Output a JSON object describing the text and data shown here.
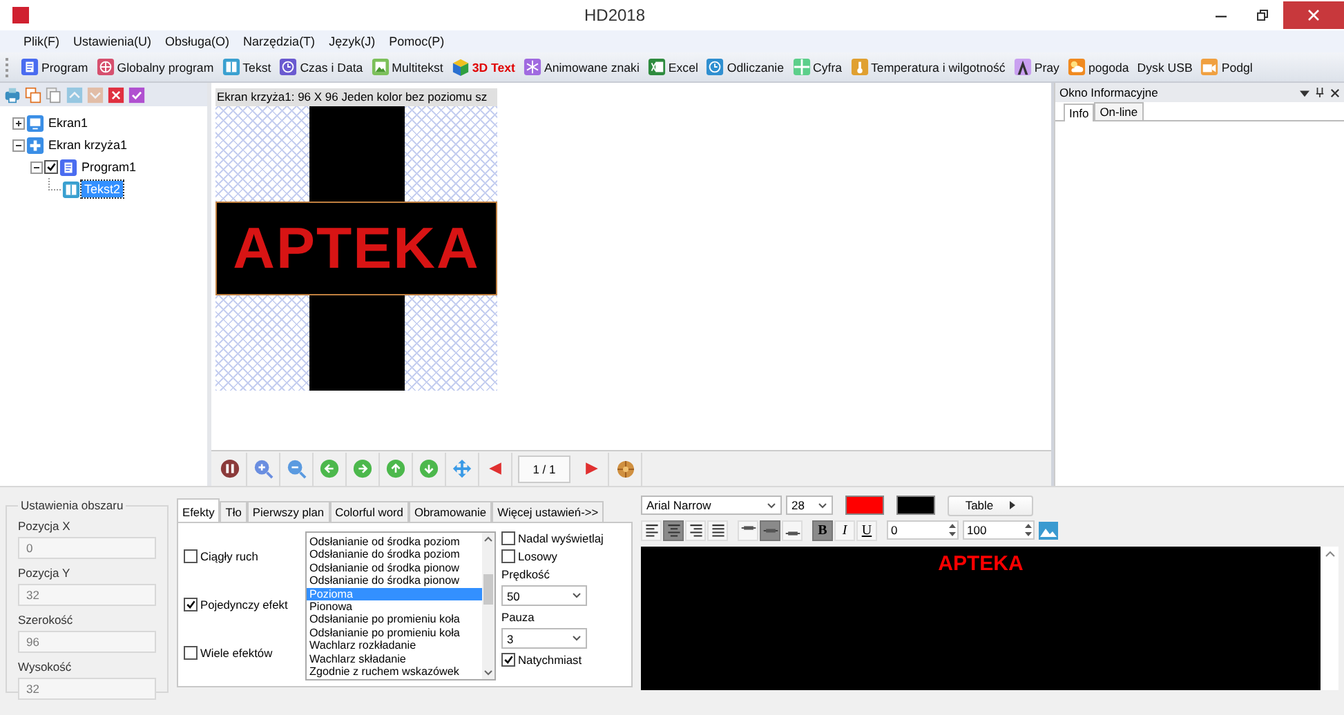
{
  "window": {
    "title": "HD2018"
  },
  "menu": [
    "Plik(F)",
    "Ustawienia(U)",
    "Obsługa(O)",
    "Narzędzia(T)",
    "Język(J)",
    "Pomoc(P)"
  ],
  "toolbar": [
    {
      "label": "Program",
      "kind": "program",
      "highlighted": false
    },
    {
      "label": "Globalny program",
      "kind": "globe",
      "highlighted": false
    },
    {
      "label": "Tekst",
      "kind": "book",
      "highlighted": false
    },
    {
      "label": "Czas i Data",
      "kind": "clock",
      "highlighted": false
    },
    {
      "label": "Multitekst",
      "kind": "picture",
      "highlighted": false
    },
    {
      "label": "3D Text",
      "kind": "cube",
      "highlighted": true
    },
    {
      "label": "Animowane znaki",
      "kind": "snowflake",
      "highlighted": false
    },
    {
      "label": "Excel",
      "kind": "spreadsheet",
      "highlighted": false
    },
    {
      "label": "Odliczanie",
      "kind": "alarm",
      "highlighted": false
    },
    {
      "label": "Cyfra",
      "kind": "grid",
      "highlighted": false
    },
    {
      "label": "Temperatura i wilgotność",
      "kind": "thermometer",
      "highlighted": false
    },
    {
      "label": "Pray",
      "kind": "tower",
      "highlighted": false
    },
    {
      "label": "pogoda",
      "kind": "weather",
      "highlighted": false
    },
    {
      "label": "Dysk USB",
      "kind": "text",
      "highlighted": false
    },
    {
      "label": "Podgl",
      "kind": "camera",
      "highlighted": false
    }
  ],
  "tree_tools": [
    {
      "kind": "print",
      "disabled": false
    },
    {
      "kind": "copy",
      "disabled": false
    },
    {
      "kind": "duplicate",
      "disabled": false
    },
    {
      "kind": "up",
      "disabled": true
    },
    {
      "kind": "down",
      "disabled": true
    },
    {
      "kind": "delete",
      "disabled": false
    },
    {
      "kind": "confirm",
      "disabled": false
    }
  ],
  "tree": [
    {
      "label": "Ekran1",
      "kind": "monitor",
      "expanded": false,
      "selected": false
    },
    {
      "label": "Ekran krzyża1",
      "kind": "cross",
      "expanded": true,
      "selected": false,
      "children": [
        {
          "label": "Program1",
          "kind": "program",
          "expanded": true,
          "checked": true,
          "selected": false,
          "children": [
            {
              "label": "Tekst2",
              "kind": "book",
              "selected": true
            }
          ]
        }
      ]
    }
  ],
  "canvas": {
    "header": "Ekran krzyża1: 96 X 96  Jeden kolor  bez poziomu sz",
    "preview_text": "APTEKA",
    "page": "1 / 1"
  },
  "info_panel": {
    "title": "Okno Informacyjne",
    "tabs": [
      {
        "label": "Info",
        "selected": true
      },
      {
        "label": "On-line",
        "selected": false
      }
    ]
  },
  "area": {
    "title": "Ustawienia obszaru",
    "fields": [
      {
        "label": "Pozycja X",
        "value": "0",
        "disabled": true
      },
      {
        "label": "Pozycja Y",
        "value": "32",
        "disabled": true
      },
      {
        "label": "Szerokość",
        "value": "96",
        "disabled": true
      },
      {
        "label": "Wysokość",
        "value": "32",
        "disabled": true
      }
    ]
  },
  "effects": {
    "tabs": [
      {
        "label": "Efekty",
        "selected": true
      },
      {
        "label": "Tło",
        "selected": false
      },
      {
        "label": "Pierwszy plan",
        "selected": false
      },
      {
        "label": "Colorful word",
        "selected": false
      },
      {
        "label": "Obramowanie",
        "selected": false
      },
      {
        "label": "Więcej ustawień->>",
        "selected": false
      }
    ],
    "modes": [
      {
        "label": "Ciągły ruch",
        "checked": false
      },
      {
        "label": "Pojedynczy efekt",
        "checked": true
      },
      {
        "label": "Wiele efektów",
        "checked": false
      }
    ],
    "list": [
      {
        "label": "Odsłanianie od środka poziom",
        "selected": false
      },
      {
        "label": "Odsłanianie do środka poziom",
        "selected": false
      },
      {
        "label": "Odsłanianie od środka pionow",
        "selected": false
      },
      {
        "label": "Odsłanianie do środka pionow",
        "selected": false
      },
      {
        "label": "Pozioma",
        "selected": true
      },
      {
        "label": "Pionowa",
        "selected": false
      },
      {
        "label": "Odsłanianie po promieniu koła",
        "selected": false
      },
      {
        "label": "Odsłanianie po promieniu koła",
        "selected": false
      },
      {
        "label": "Wachlarz rozkładanie",
        "selected": false
      },
      {
        "label": "Wachlarz składanie",
        "selected": false
      },
      {
        "label": "Zgodnie z ruchem wskazówek",
        "selected": false
      }
    ],
    "options": [
      {
        "kind": "checkbox",
        "label": "Nadal wyświetlaj",
        "checked": false
      },
      {
        "kind": "checkbox",
        "label": "Losowy",
        "checked": false
      },
      {
        "kind": "select",
        "label": "Prędkość",
        "value": "50"
      },
      {
        "kind": "select",
        "label": "Pauza",
        "value": "3"
      },
      {
        "kind": "checkbox",
        "label": "Natychmiast",
        "checked": true
      }
    ]
  },
  "editor": {
    "font": "Arial Narrow",
    "size": "28",
    "swatches": [
      {
        "kind": "text",
        "color": "#ff0000"
      },
      {
        "kind": "background",
        "color": "#000000"
      }
    ],
    "table_button": "Table",
    "align": [
      {
        "kind": "left",
        "selected": false
      },
      {
        "kind": "center",
        "selected": true
      },
      {
        "kind": "right",
        "selected": false
      },
      {
        "kind": "justify",
        "selected": false
      }
    ],
    "valign": [
      {
        "kind": "top",
        "selected": false
      },
      {
        "kind": "middle",
        "selected": true
      },
      {
        "kind": "bottom",
        "selected": false
      }
    ],
    "style": [
      {
        "kind": "bold",
        "label": "B",
        "selected": true
      },
      {
        "kind": "italic",
        "label": "I",
        "selected": false
      },
      {
        "kind": "underline",
        "label": "U",
        "selected": false
      }
    ],
    "spin_1": "0",
    "spin_2": "100",
    "text": "APTEKA"
  }
}
